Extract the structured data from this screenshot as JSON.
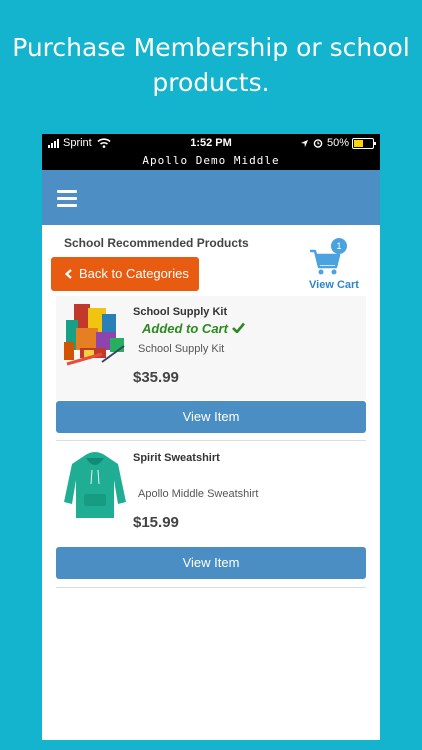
{
  "headline": "Purchase Membership or school products.",
  "status_bar": {
    "carrier": "Sprint",
    "time": "1:52 PM",
    "battery": "50%",
    "battery_level": 0.5,
    "battery_color": "#ffd400"
  },
  "app_title": "Apollo Demo Middle",
  "section_title": "School Recommended Products",
  "back_button": "Back to Categories",
  "cart": {
    "count": "1",
    "label": "View Cart"
  },
  "colors": {
    "background": "#14b4cf",
    "nav": "#4d8fc4",
    "back_button": "#e85c11",
    "view_button": "#4b8ec4",
    "added": "#2b8a1f",
    "cart": "#2f86c8"
  },
  "products": [
    {
      "name": "School Supply Kit",
      "status": "Added to Cart",
      "description": "School Supply Kit",
      "price": "$35.99",
      "button": "View Item",
      "image": "school-supplies"
    },
    {
      "name": "Spirit Sweatshirt",
      "description": "Apollo Middle Sweatshirt",
      "price": "$15.99",
      "button": "View Item",
      "image": "green-hoodie"
    }
  ]
}
